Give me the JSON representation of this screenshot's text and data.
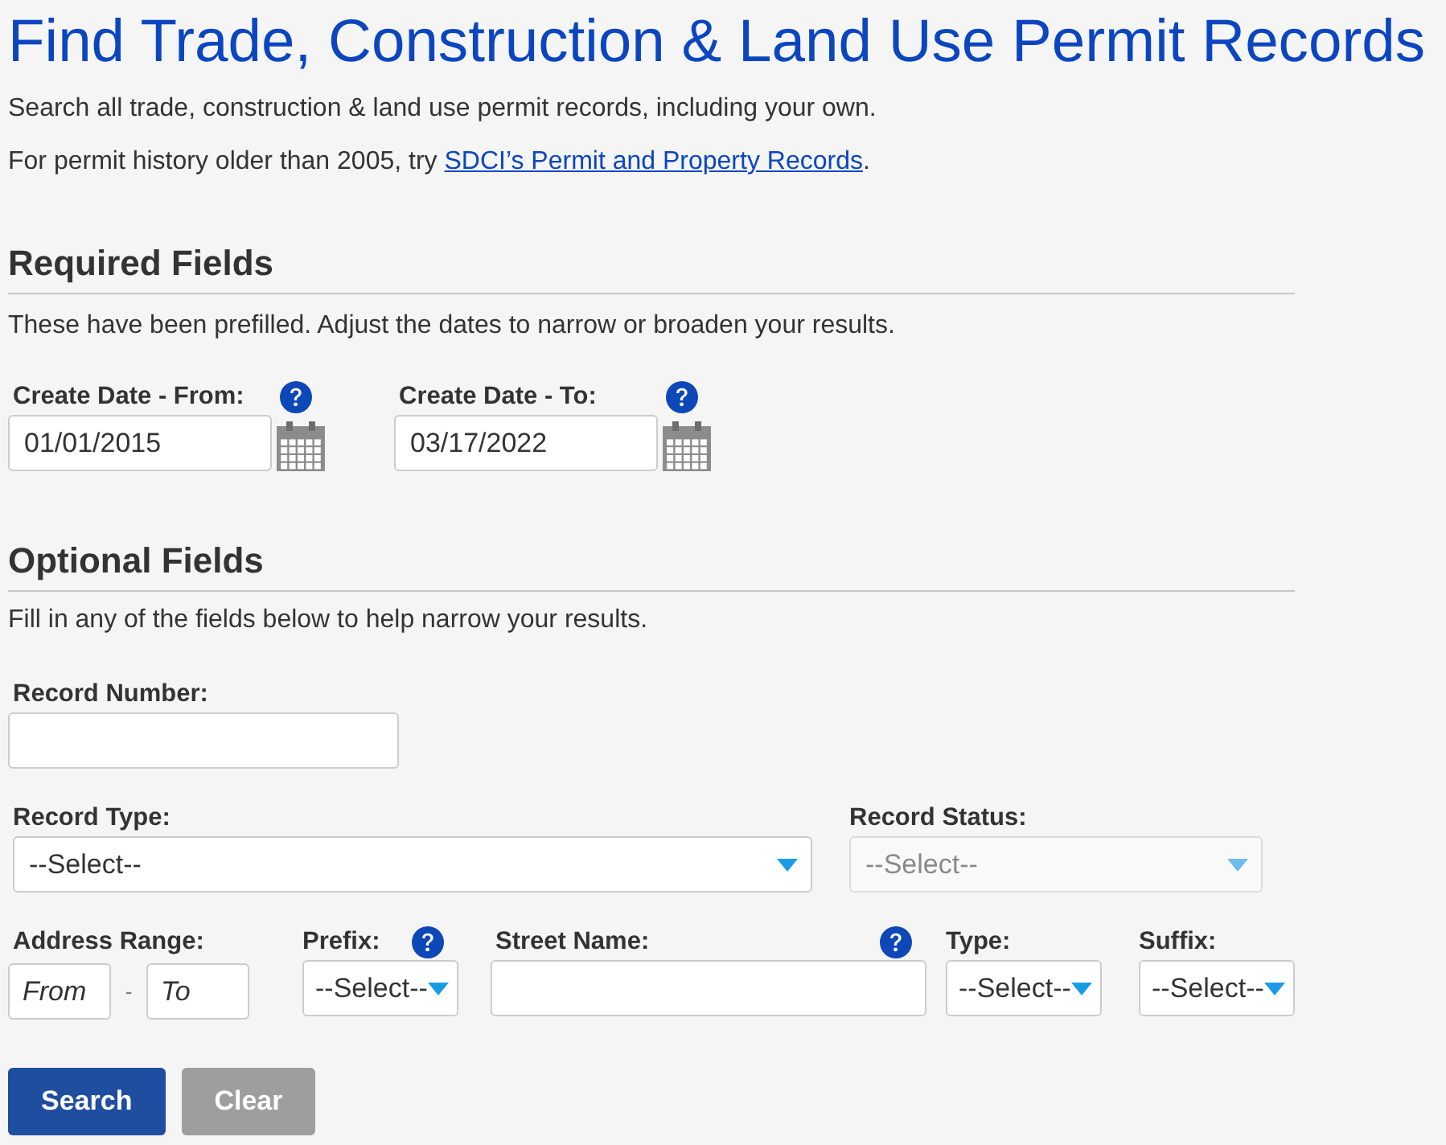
{
  "page": {
    "title": "Find Trade, Construction & Land Use Permit Records",
    "intro": "Search all trade, construction & land use permit records, including your own.",
    "history_note": {
      "text": "For permit history older than 2005, try ",
      "link": "SDCI’s Permit and Property Records",
      "text_after": "."
    }
  },
  "required_fields": {
    "heading": "Required Fields",
    "description": "These have been prefilled. Adjust the dates to narrow or broaden your results.",
    "fields": [
      {
        "kind": "date",
        "label": "Create Date - From:",
        "value": "01/01/2015",
        "help": true
      },
      {
        "kind": "date",
        "label": "Create Date - To:",
        "value": "03/17/2022",
        "help": true
      }
    ]
  },
  "optional_fields": {
    "heading": "Optional Fields",
    "description": "Fill in any of the fields below to help narrow your results.",
    "rows": [
      {
        "fields": [
          {
            "kind": "text",
            "label": "Record Number:",
            "help": false,
            "disabled": false
          }
        ]
      },
      {
        "fields": [
          {
            "kind": "select",
            "label": "Record Type:",
            "value": "--Select--",
            "help": false,
            "disabled": false
          },
          {
            "kind": "select",
            "label": "Record Status:",
            "value": "--Select--",
            "help": false,
            "disabled": true
          }
        ]
      },
      {
        "fields": [
          {
            "kind": "range",
            "label": "Address Range:",
            "from_placeholder": "From",
            "separator": "-",
            "to_placeholder": "To",
            "help": false,
            "disabled": false
          },
          {
            "kind": "select",
            "label": "Prefix:",
            "value": "--Select--",
            "help": true,
            "disabled": false
          },
          {
            "kind": "text",
            "label": "Street Name:",
            "help": true,
            "disabled": false
          },
          {
            "kind": "select",
            "label": "Type:",
            "value": "--Select--",
            "help": false,
            "disabled": false
          },
          {
            "kind": "select",
            "label": "Suffix:",
            "value": "--Select--",
            "help": false,
            "disabled": false
          }
        ]
      }
    ]
  },
  "buttons": [
    {
      "kind": "primary",
      "label": "Search"
    },
    {
      "kind": "secondary",
      "label": "Clear"
    }
  ]
}
